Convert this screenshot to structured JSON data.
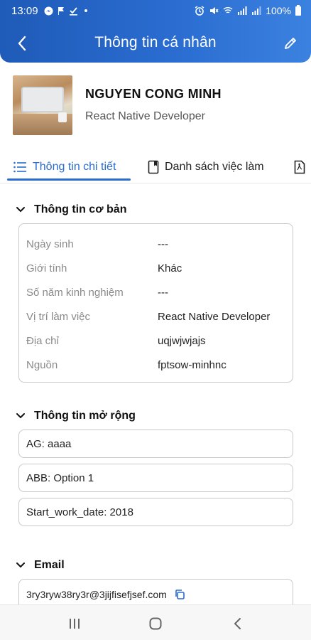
{
  "status_bar": {
    "time": "13:09",
    "battery": "100%"
  },
  "header": {
    "title": "Thông tin cá nhân"
  },
  "profile": {
    "name": "NGUYEN CONG MINH",
    "role": "React Native Developer"
  },
  "tabs": [
    {
      "label": "Thông tin chi tiết",
      "active": true
    },
    {
      "label": "Danh sách việc làm",
      "active": false
    }
  ],
  "basic_info": {
    "title": "Thông tin cơ bản",
    "rows": [
      {
        "label": "Ngày sinh",
        "value": "---"
      },
      {
        "label": "Giới tính",
        "value": "Khác"
      },
      {
        "label": "Số năm kinh nghiệm",
        "value": "---"
      },
      {
        "label": "Vị trí làm việc",
        "value": "React Native Developer"
      },
      {
        "label": "Địa chỉ",
        "value": "uqjwjwjajs"
      },
      {
        "label": "Nguồn",
        "value": "fptsow-minhnc"
      }
    ]
  },
  "extended_info": {
    "title": "Thông tin mở rộng",
    "fields": [
      "AG: aaaa",
      "ABB: Option 1",
      "Start_work_date: 2018"
    ]
  },
  "email": {
    "title": "Email",
    "value": "3ry3ryw38ry3r@3jijfisefjsef.com"
  },
  "colors": {
    "primary": "#2a6cd0",
    "header_gradient_start": "#1f5bb8",
    "header_gradient_end": "#3b82e0"
  },
  "icons": {
    "back": "chevron-left-icon",
    "edit": "pencil-icon",
    "tab_detail": "list-icon",
    "tab_jobs": "bookmark-icon",
    "tab_pdf": "pdf-icon",
    "section_toggle": "chevron-down-icon",
    "copy": "copy-icon",
    "nav_recents": "recents-icon",
    "nav_home": "home-icon",
    "nav_back": "back-icon"
  }
}
